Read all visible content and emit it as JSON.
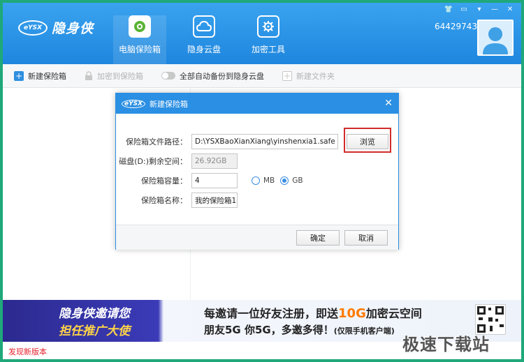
{
  "window": {
    "logo_badge": "eYSX",
    "logo_name": "隐身侠",
    "nav": [
      {
        "label": "电脑保险箱",
        "icon": "safe-icon",
        "active": true
      },
      {
        "label": "隐身云盘",
        "icon": "cloud-icon",
        "active": false
      },
      {
        "label": "加密工具",
        "icon": "gear-icon",
        "active": false
      }
    ],
    "user_id": "64429743"
  },
  "toolbar": {
    "new_safe": "新建保险箱",
    "add_to_safe": "加密到保险箱",
    "auto_backup": "全部自动备份到隐身云盘",
    "new_folder": "新建文件夹"
  },
  "dialog": {
    "logo": "eYSX",
    "title": "新建保险箱",
    "path_label": "保险箱文件路径：",
    "path_value": "D:\\YSXBaoXianXiang\\yinshenxia1.safe",
    "browse_label": "浏览",
    "free_label": "磁盘(D:)剩余空间：",
    "free_value": "26.92GB",
    "capacity_label": "保险箱容量：",
    "capacity_value": "4",
    "unit_mb": "MB",
    "unit_gb": "GB",
    "name_label": "保险箱名称：",
    "name_value": "我的保险箱1",
    "ok_label": "确定",
    "cancel_label": "取消"
  },
  "banner": {
    "left_line1": "隐身侠邀请您",
    "left_line2": "担任推广大使",
    "center_line1_a": "每邀请一位好友注册，即送",
    "center_line1_b": "10G",
    "center_line1_c": "加密云空间",
    "center_line2_a": "朋友5G  你5G，多邀多得！",
    "center_line2_b": "(仅限手机客户端)"
  },
  "status": {
    "new_version": "发现新版本"
  },
  "watermark": "极速下载站"
}
